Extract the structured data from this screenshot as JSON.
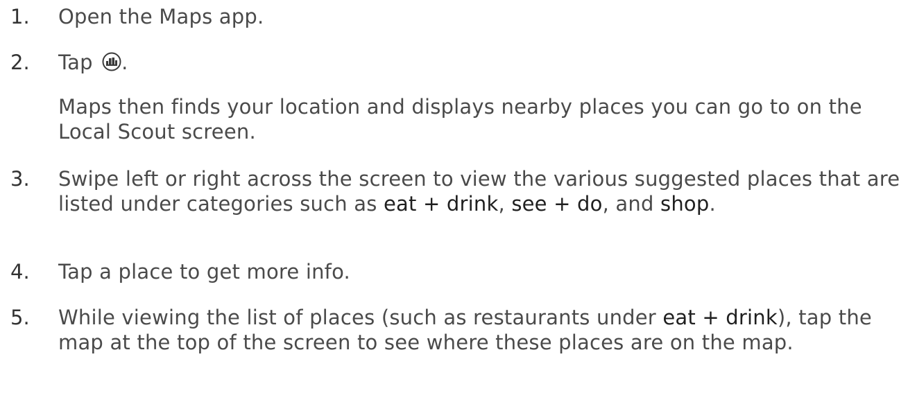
{
  "steps": [
    {
      "number": "1.",
      "text": "Open the Maps app."
    },
    {
      "number": "2.",
      "text_before_icon": "Tap",
      "icon": "local-scout-icon",
      "text_after_icon": ".",
      "description": "Maps then finds your location and displays nearby places you can go to on the Local Scout screen."
    },
    {
      "number": "3.",
      "parts": [
        "Swipe left or right across the screen to view the various suggested places that are listed under categories such as ",
        "eat + drink",
        ", ",
        "see + do",
        ", and ",
        "shop",
        "."
      ]
    },
    {
      "number": "4.",
      "text": "Tap a place to get more info."
    },
    {
      "number": "5.",
      "parts": [
        "While viewing the list of places (such as restaurants under ",
        "eat + drink",
        "), tap the map at the top of the screen to see where these places are on the map."
      ]
    }
  ]
}
